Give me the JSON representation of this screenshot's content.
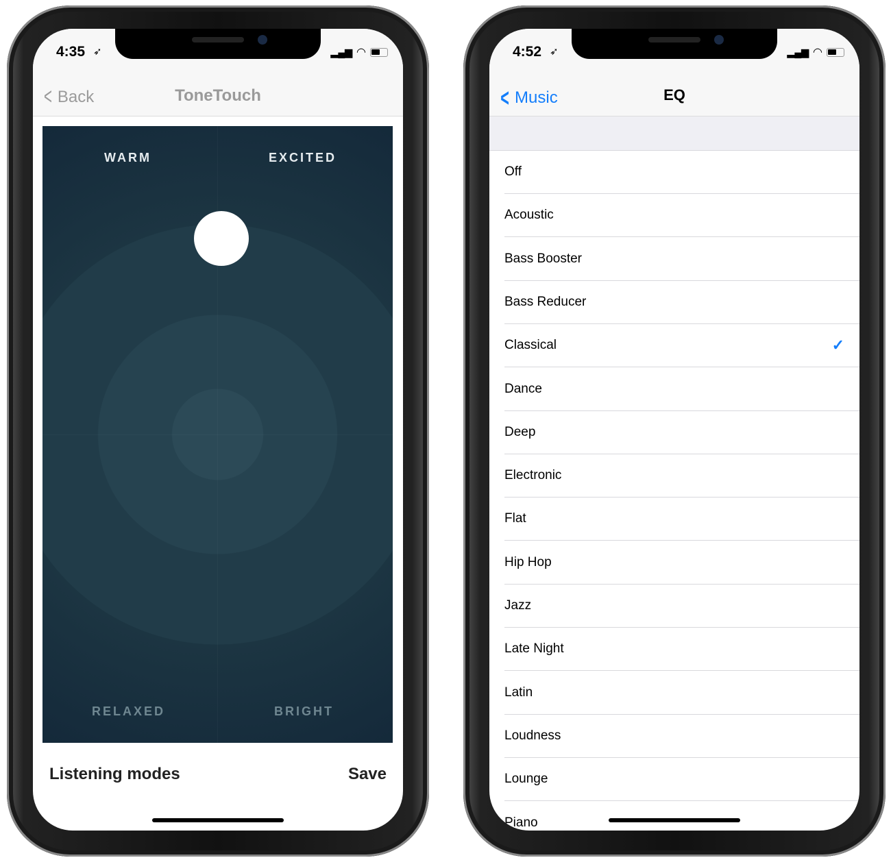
{
  "left": {
    "status": {
      "time": "4:35"
    },
    "nav": {
      "back": "Back",
      "title": "ToneTouch"
    },
    "pad": {
      "labels": {
        "top_left": "WARM",
        "top_right": "EXCITED",
        "bottom_left": "RELAXED",
        "bottom_right": "BRIGHT"
      },
      "bg_color": "#1f3a47"
    },
    "footer": {
      "title": "Listening modes",
      "save": "Save"
    }
  },
  "right": {
    "status": {
      "time": "4:52"
    },
    "nav": {
      "back": "Music",
      "title": "EQ"
    },
    "accent": "#147efb",
    "items": [
      {
        "label": "Off"
      },
      {
        "label": "Acoustic"
      },
      {
        "label": "Bass Booster"
      },
      {
        "label": "Bass Reducer"
      },
      {
        "label": "Classical",
        "selected": true
      },
      {
        "label": "Dance"
      },
      {
        "label": "Deep"
      },
      {
        "label": "Electronic"
      },
      {
        "label": "Flat"
      },
      {
        "label": "Hip Hop"
      },
      {
        "label": "Jazz"
      },
      {
        "label": "Late Night"
      },
      {
        "label": "Latin"
      },
      {
        "label": "Loudness"
      },
      {
        "label": "Lounge"
      },
      {
        "label": "Piano"
      }
    ]
  }
}
